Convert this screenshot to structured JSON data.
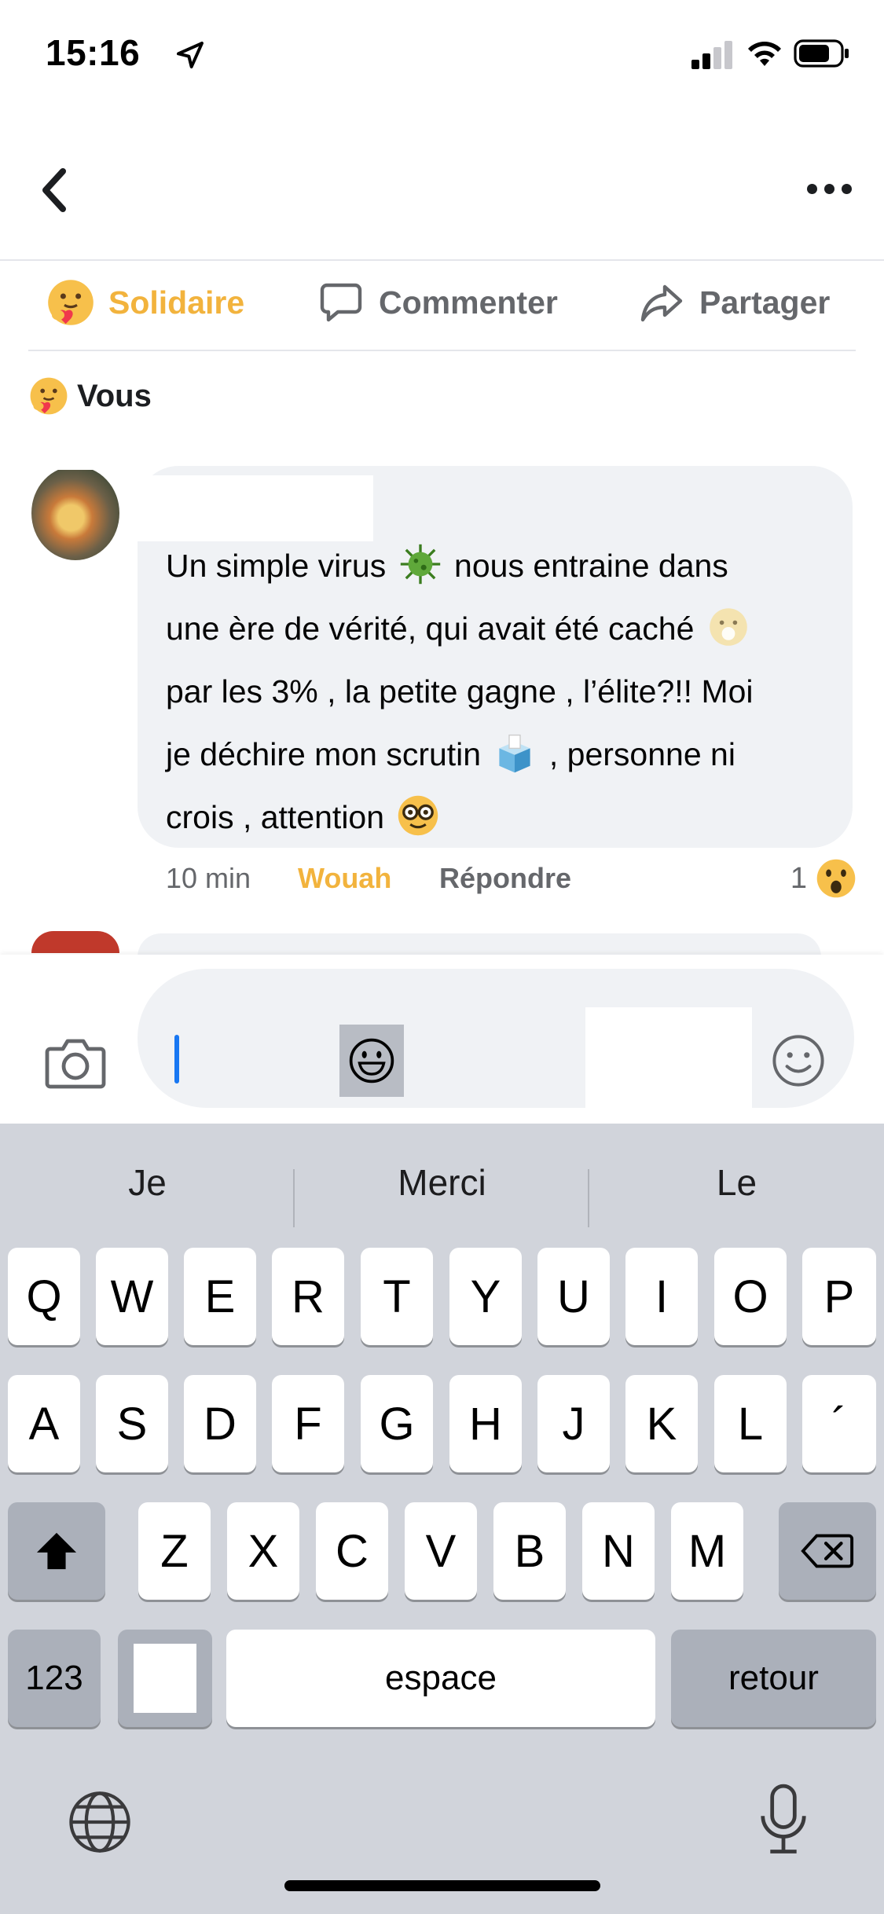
{
  "status": {
    "time": "15:16"
  },
  "post_actions": {
    "react_label": "Solidaire",
    "comment_label": "Commenter",
    "share_label": "Partager"
  },
  "reactors": {
    "label": "Vous"
  },
  "comment": {
    "lines": [
      "Un simple virus",
      "nous entraine dans",
      "une ère de vérité, qui avait été caché",
      "par les 3% , la petite gagne , l’élite?!! Moi",
      "je déchire mon scrutin",
      ", personne ni",
      "crois , attention"
    ],
    "time": "10 min",
    "reaction_label": "Wouah",
    "reply_label": "Répondre",
    "reaction_count": "1"
  },
  "composer": {
    "placeholder": ""
  },
  "keyboard": {
    "suggestions": [
      "Je",
      "Merci",
      "Le"
    ],
    "row1": [
      "Q",
      "W",
      "E",
      "R",
      "T",
      "Y",
      "U",
      "I",
      "O",
      "P"
    ],
    "row2": [
      "A",
      "S",
      "D",
      "F",
      "G",
      "H",
      "J",
      "K",
      "L",
      "´"
    ],
    "row3": [
      "Z",
      "X",
      "C",
      "V",
      "B",
      "N",
      "M"
    ],
    "numbers_label": "123",
    "space_label": "espace",
    "return_label": "retour"
  },
  "icons": {
    "back": "chevron-left-icon",
    "more": "more-dots-icon",
    "camera": "camera-icon",
    "emoji": "smiley-icon",
    "shift": "shift-icon",
    "delete": "backspace-icon",
    "globe": "globe-icon",
    "mic": "microphone-icon"
  },
  "colors": {
    "accent": "#f2b33d",
    "link_blue": "#1877f2",
    "keyboard_bg": "#d1d4db"
  }
}
